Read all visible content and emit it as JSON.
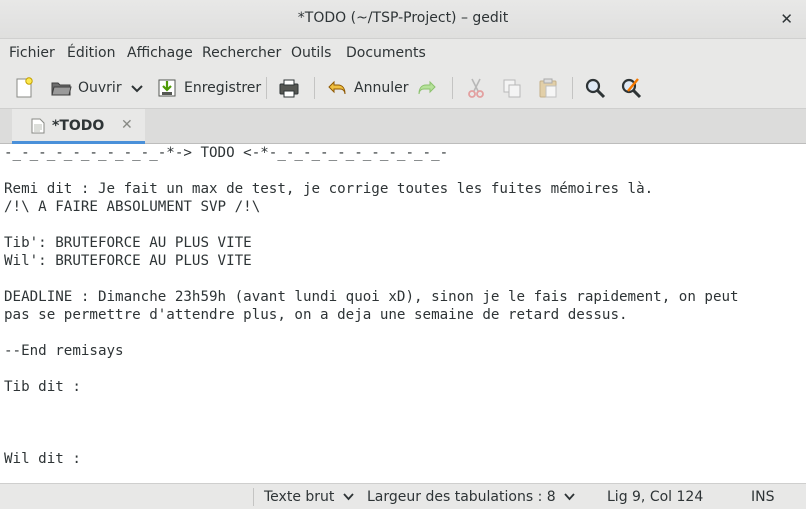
{
  "window": {
    "title": "*TODO (~/TSP-Project) – gedit",
    "close_glyph": "✕"
  },
  "menu": [
    "Fichier",
    "Édition",
    "Affichage",
    "Rechercher",
    "Outils",
    "Documents"
  ],
  "toolbar": {
    "open_label": "Ouvrir",
    "save_label": "Enregistrer",
    "undo_label": "Annuler",
    "dropdown_glyph": "⌄"
  },
  "tab": {
    "label": "*TODO",
    "close_glyph": "✕"
  },
  "editor": {
    "lines": [
      "-_-_-_-_-_-_-_-_-_-*-> TODO <-*-_-_-_-_-_-_-_-_-_-_-",
      "",
      "Remi dit : Je fait un max de test, je corrige toutes les fuites mémoires là.",
      "/!\\ A FAIRE ABSOLUMENT SVP /!\\",
      "",
      "Tib': BRUTEFORCE AU PLUS VITE",
      "Wil': BRUTEFORCE AU PLUS VITE",
      "",
      "DEADLINE : Dimanche 23h59h (avant lundi quoi xD), sinon je le fais rapidement, on peut",
      "pas se permettre d'attendre plus, on a deja une semaine de retard dessus.",
      "",
      "--End remisays",
      "",
      "Tib dit :",
      "",
      "",
      "",
      "Wil dit :"
    ]
  },
  "status": {
    "language": "Texte brut",
    "tab_width": "Largeur des tabulations : 8",
    "position": "Lig 9, Col 124",
    "mode": "INS"
  }
}
